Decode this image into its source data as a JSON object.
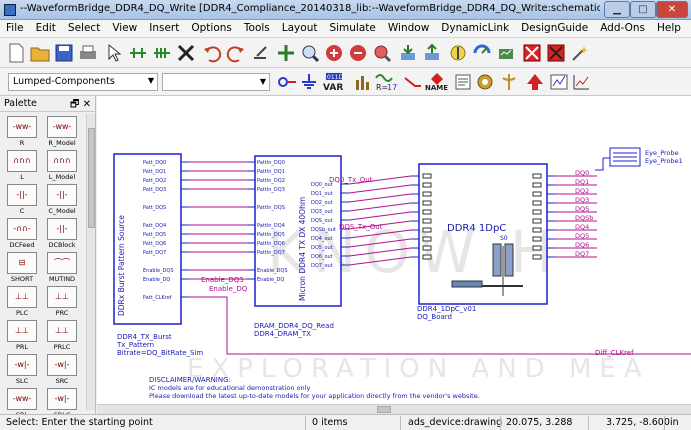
{
  "window": {
    "title": "--WaveformBridge_DDR4_DQ_Write [DDR4_Compliance_20140318_lib:--WaveformBridge_DDR4_DQ_Write:schematic] (Schematic):6",
    "min_glyph": "▁",
    "max_glyph": "□",
    "close_glyph": "✕"
  },
  "menu": [
    "File",
    "Edit",
    "Select",
    "View",
    "Insert",
    "Options",
    "Tools",
    "Layout",
    "Simulate",
    "Window",
    "DynamicLink",
    "DesignGuide",
    "Add-Ons",
    "Help"
  ],
  "toolbar2": {
    "component_library": "Lumped-Components",
    "var_label": "VAR",
    "var_num": "011D",
    "r_label": "R=",
    "r_num": "17",
    "name_label": "NAME"
  },
  "palette": {
    "title": "Palette",
    "pin_glyph": "🗗",
    "close_glyph": "✕",
    "items": [
      "R",
      "R_Model",
      "L",
      "L_Model",
      "C",
      "C_Model",
      "DCFeed",
      "DCBlock",
      "SHORT",
      "MUTIND",
      "PLC",
      "PRC",
      "PRL",
      "PRLC",
      "SLC",
      "SRC",
      "SRL",
      "SRLC"
    ]
  },
  "schematic": {
    "source_block": {
      "title": "DDRx Burst Pattern Source",
      "pins": [
        "Patt_DQ0",
        "Patt_DQ1",
        "Patt_DQ2",
        "Patt_DQ3",
        "Patt_DQS",
        "Patt_DQ4",
        "Patt_DQ5",
        "Patt_DQ6",
        "Patt_DQ7",
        "Enable_DQS",
        "Enable_DQ",
        "Patt_CLKref"
      ],
      "instance": "DDR4_TX_Burst",
      "param1": "Tx_Pattern",
      "param2": "Bitrate=DQ_BitRate_Sim"
    },
    "tx_block": {
      "title": "Micron DDR4 TX DX 40Ohm",
      "in_pins": [
        "PattIn_DQ0",
        "PattIn_DQ1",
        "PattIn_DQ2",
        "PattIn_DQ3",
        "PattIn_DQS",
        "PattIn_DQ4",
        "PattIn_DQ5",
        "PattIn_DQ6",
        "PattIn_DQ7",
        "Enable_DQS",
        "Enable_DQ"
      ],
      "out_pins": [
        "DQ0_out",
        "DQ1_out",
        "DQ2_out",
        "DQ3_out",
        "DQS_out",
        "DQSb_out",
        "DQ4_out",
        "DQ5_out",
        "DQ6_out",
        "DQ7_out"
      ],
      "instance": "DRAM_DDR4_DQ_Read",
      "param1": "DDR4_DRAM_TX"
    },
    "board_block": {
      "title": "DDR4 1DpC",
      "s0": "S0",
      "instance": "DDR4_1DpC_v01",
      "param1": "DQ_Board"
    },
    "probe": {
      "label1": "Eye_Probe",
      "label2": "Eye_Probe1"
    },
    "nets": {
      "enable_dqs": "Enable_DQS",
      "enable_dq": "Enable_DQ",
      "dq0_tx_out": "DQ0_Tx_Out",
      "dqs_tx_out": "DQS_Tx_Out",
      "outputs": [
        "DQ0",
        "DQ1",
        "DQ2",
        "DQ3",
        "DQS",
        "DQSb",
        "DQ4",
        "DQ5",
        "DQ6",
        "DQ7"
      ],
      "diff_clk": "Diff_CLKref"
    },
    "disclaimer": {
      "title": "DISCLAIMER/WARNING:",
      "line1": "IC models are for educational demonstration only",
      "line2": "Please download the latest up-to-date models for your application directly from the vendor's website."
    },
    "watermark1": "KNOW H",
    "watermark2": "EXPLORATION AND MEA"
  },
  "status": {
    "prompt": "Select: Enter the starting point",
    "items": "0 items",
    "context": "ads_device:drawing",
    "coord1": "20.075, 3.288",
    "coord2": "3.725, -8.600",
    "units": "in"
  },
  "colors": {
    "wire_blue": "#1f1fd0",
    "net_magenta": "#b0108c",
    "text_blue": "#1a1ab0"
  }
}
